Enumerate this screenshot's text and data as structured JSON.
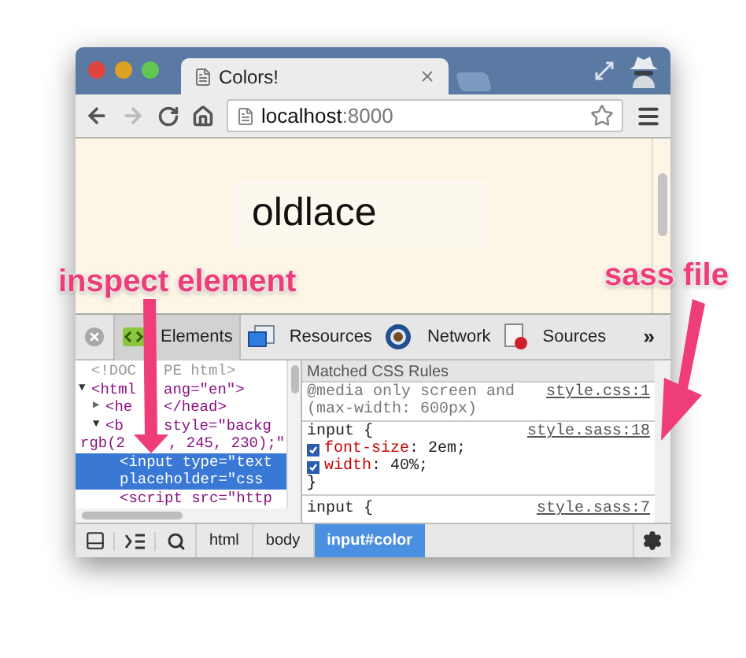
{
  "window": {
    "tab_title": "Colors!",
    "address_host": "localhost",
    "address_port": ":8000"
  },
  "page": {
    "swatch_text": "oldlace"
  },
  "devtools": {
    "tabs": [
      {
        "label": "Elements",
        "kind": "elements",
        "selected": true
      },
      {
        "label": "Resources",
        "kind": "resources",
        "selected": false
      },
      {
        "label": "Network",
        "kind": "network",
        "selected": false
      },
      {
        "label": "Sources",
        "kind": "sources",
        "selected": false
      }
    ],
    "more": "»",
    "dom_tree": [
      {
        "lines": [
          [
            "<!DOC",
            "PE html>"
          ]
        ],
        "selected": false
      },
      {
        "lines": [
          [
            "<html",
            "ang=\"en\">"
          ]
        ],
        "toggle": "▼",
        "expanded": true,
        "selected": false,
        "children": [
          {
            "lines": [
              [
                "<he",
                "</head>"
              ]
            ],
            "toggle": "▶",
            "expanded": false,
            "selected": false
          },
          {
            "lines": [
              [
                "<b",
                "style=\"backg"
              ],
              [
                "rgb(2",
                ", 245, 230);\""
              ]
            ],
            "toggle": "▼",
            "expanded": true,
            "selected": false,
            "children": [
              {
                "lines": [
                  [
                    "<input type=\"text"
                  ],
                  [
                    "placeholder=\"css"
                  ]
                ],
                "selected": true
              },
              {
                "lines": [
                  [
                    "<script src=\"http"
                  ]
                ],
                "selected": false
              }
            ]
          }
        ]
      }
    ],
    "styles_header": "Matched CSS Rules",
    "rules": [
      {
        "selector_lines": [
          "@media only screen and",
          "(max-width: 600px)"
        ],
        "source": "style.css:1"
      },
      {
        "selector_lines": [
          "input {"
        ],
        "source": "style.sass:18",
        "properties": [
          {
            "name": "font-size",
            "value": ": 2em;",
            "checked": true
          },
          {
            "name": "width",
            "value": ": 40%;",
            "checked": true
          }
        ],
        "close": "}"
      },
      {
        "selector_lines": [
          "input {"
        ],
        "source": "style.sass:7"
      }
    ],
    "breadcrumbs": [
      {
        "label": "html",
        "selected": false
      },
      {
        "label": "body",
        "selected": false
      },
      {
        "label": "input#color",
        "selected": true
      }
    ]
  },
  "annotations": [
    {
      "text": "inspect element"
    },
    {
      "text": "sass file"
    }
  ]
}
